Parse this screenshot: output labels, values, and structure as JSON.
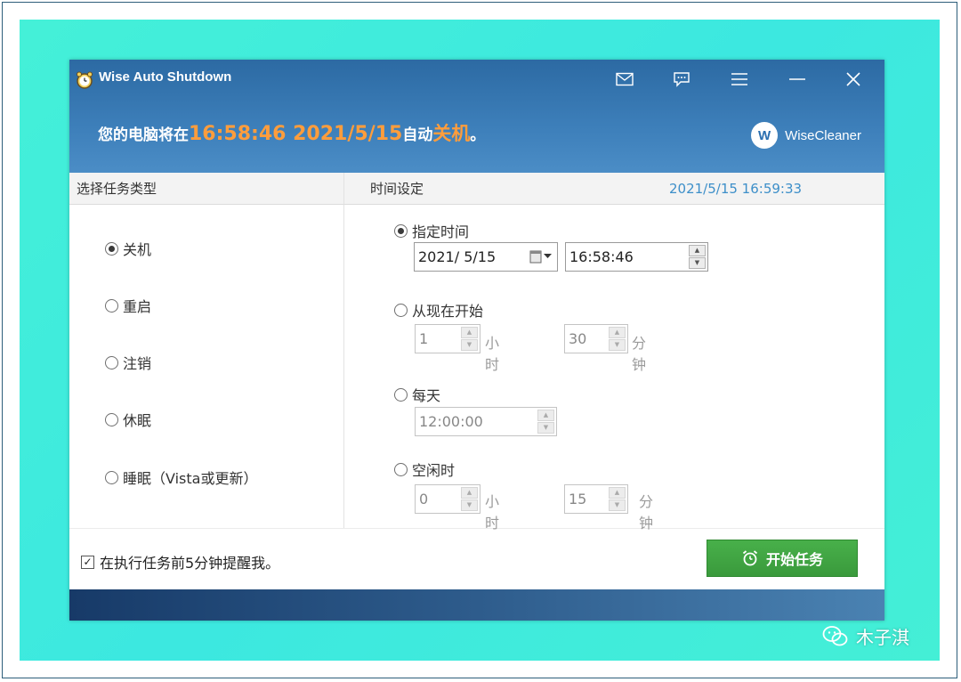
{
  "window": {
    "title": "Wise Auto Shutdown",
    "banner": {
      "prefix": "您的电脑将在",
      "time": "16:58:46 2021/5/15",
      "middle": "自动",
      "action": "关机",
      "suffix": "。"
    },
    "brand": {
      "logo_letter": "W",
      "name": "WiseCleaner"
    }
  },
  "left_panel": {
    "header": "选择任务类型",
    "options": [
      {
        "label": "关机",
        "checked": true
      },
      {
        "label": "重启",
        "checked": false
      },
      {
        "label": "注销",
        "checked": false
      },
      {
        "label": "休眠",
        "checked": false
      },
      {
        "label": "睡眠（Vista或更新）",
        "checked": false
      }
    ]
  },
  "right_panel": {
    "header": "时间设定",
    "current_time": "2021/5/15 16:59:33",
    "specific_time": {
      "label": "指定时间",
      "date": "2021/  5/15",
      "time": "16:58:46"
    },
    "from_now": {
      "label": "从现在开始",
      "hours": "1",
      "hours_unit": "小时",
      "minutes": "30",
      "minutes_unit": "分钟"
    },
    "daily": {
      "label": "每天",
      "time": "12:00:00"
    },
    "idle": {
      "label": "空闲时",
      "hours": "0",
      "hours_unit": "小时",
      "minutes": "15",
      "minutes_unit": "分钟"
    }
  },
  "footer": {
    "remind_label": "在执行任务前5分钟提醒我。",
    "remind_checked": true,
    "start_button": "开始任务"
  },
  "watermark": {
    "text": "木子淇"
  },
  "colors": {
    "title_blue": "#2c6aa3",
    "highlight_orange": "#ff9d3c",
    "start_green": "#3fa541",
    "timestamp_blue": "#3d8fc9"
  }
}
